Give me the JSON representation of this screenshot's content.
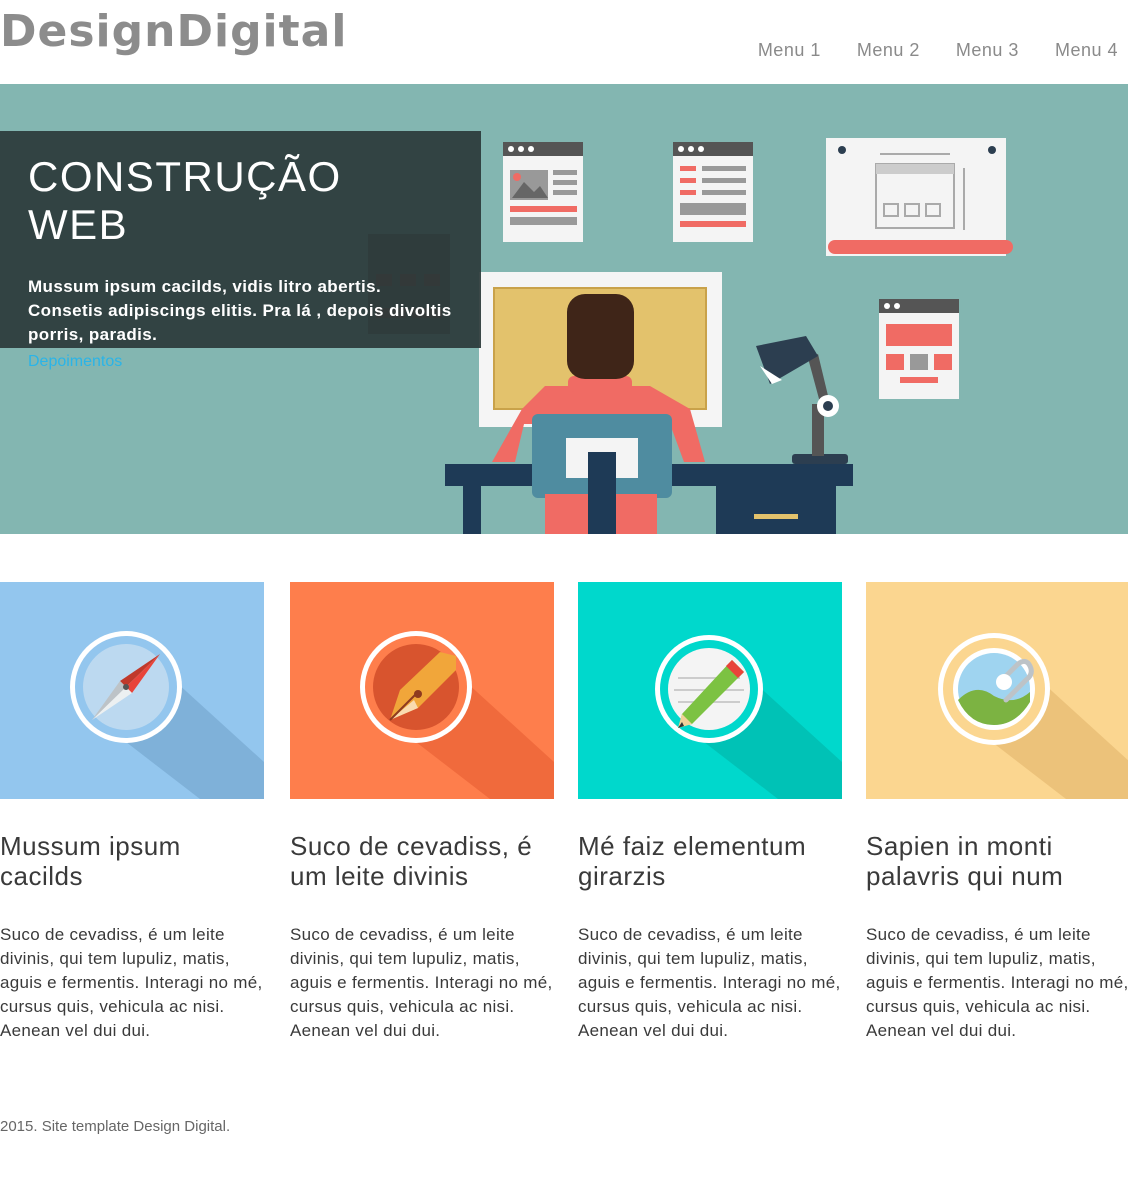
{
  "header": {
    "logo": "DesignDigital",
    "menu": [
      "Menu 1",
      "Menu 2",
      "Menu 3",
      "Menu 4"
    ]
  },
  "hero": {
    "title": "CONSTRUÇÃO WEB",
    "text": "Mussum ipsum cacilds, vidis litro abertis. Consetis adipiscings elitis. Pra lá , depois divoltis porris, paradis.",
    "link": "Depoimentos"
  },
  "features": [
    {
      "icon": "compass-icon",
      "color": "#93c6ee",
      "title": "Mussum ipsum cacilds",
      "text": "Suco de cevadiss, é um leite divinis, qui tem lupuliz, matis, aguis e fermentis. Interagi no mé, cursus quis, vehicula ac nisi. Aenean vel dui dui."
    },
    {
      "icon": "pen-nib-icon",
      "color": "#fe7e4c",
      "title": "Suco de cevadiss, é um leite divinis",
      "text": "Suco de cevadiss, é um leite divinis, qui tem lupuliz, matis, aguis e fermentis. Interagi no mé, cursus quis, vehicula ac nisi. Aenean vel dui dui."
    },
    {
      "icon": "pencil-icon",
      "color": "#00d8cc",
      "title": "Mé faiz elementum girarzis",
      "text": "Suco de cevadiss, é um leite divinis, qui tem lupuliz, matis, aguis e fermentis. Interagi no mé, cursus quis, vehicula ac nisi. Aenean vel dui dui."
    },
    {
      "icon": "paperclip-photo-icon",
      "color": "#fbd690",
      "title": "Sapien in monti palavris qui num",
      "text": "Suco de cevadiss, é um leite divinis, qui tem lupuliz, matis, aguis e fermentis. Interagi no mé, cursus quis, vehicula ac nisi. Aenean vel dui dui."
    }
  ],
  "footer": {
    "text": "2015. Site template Design Digital."
  }
}
